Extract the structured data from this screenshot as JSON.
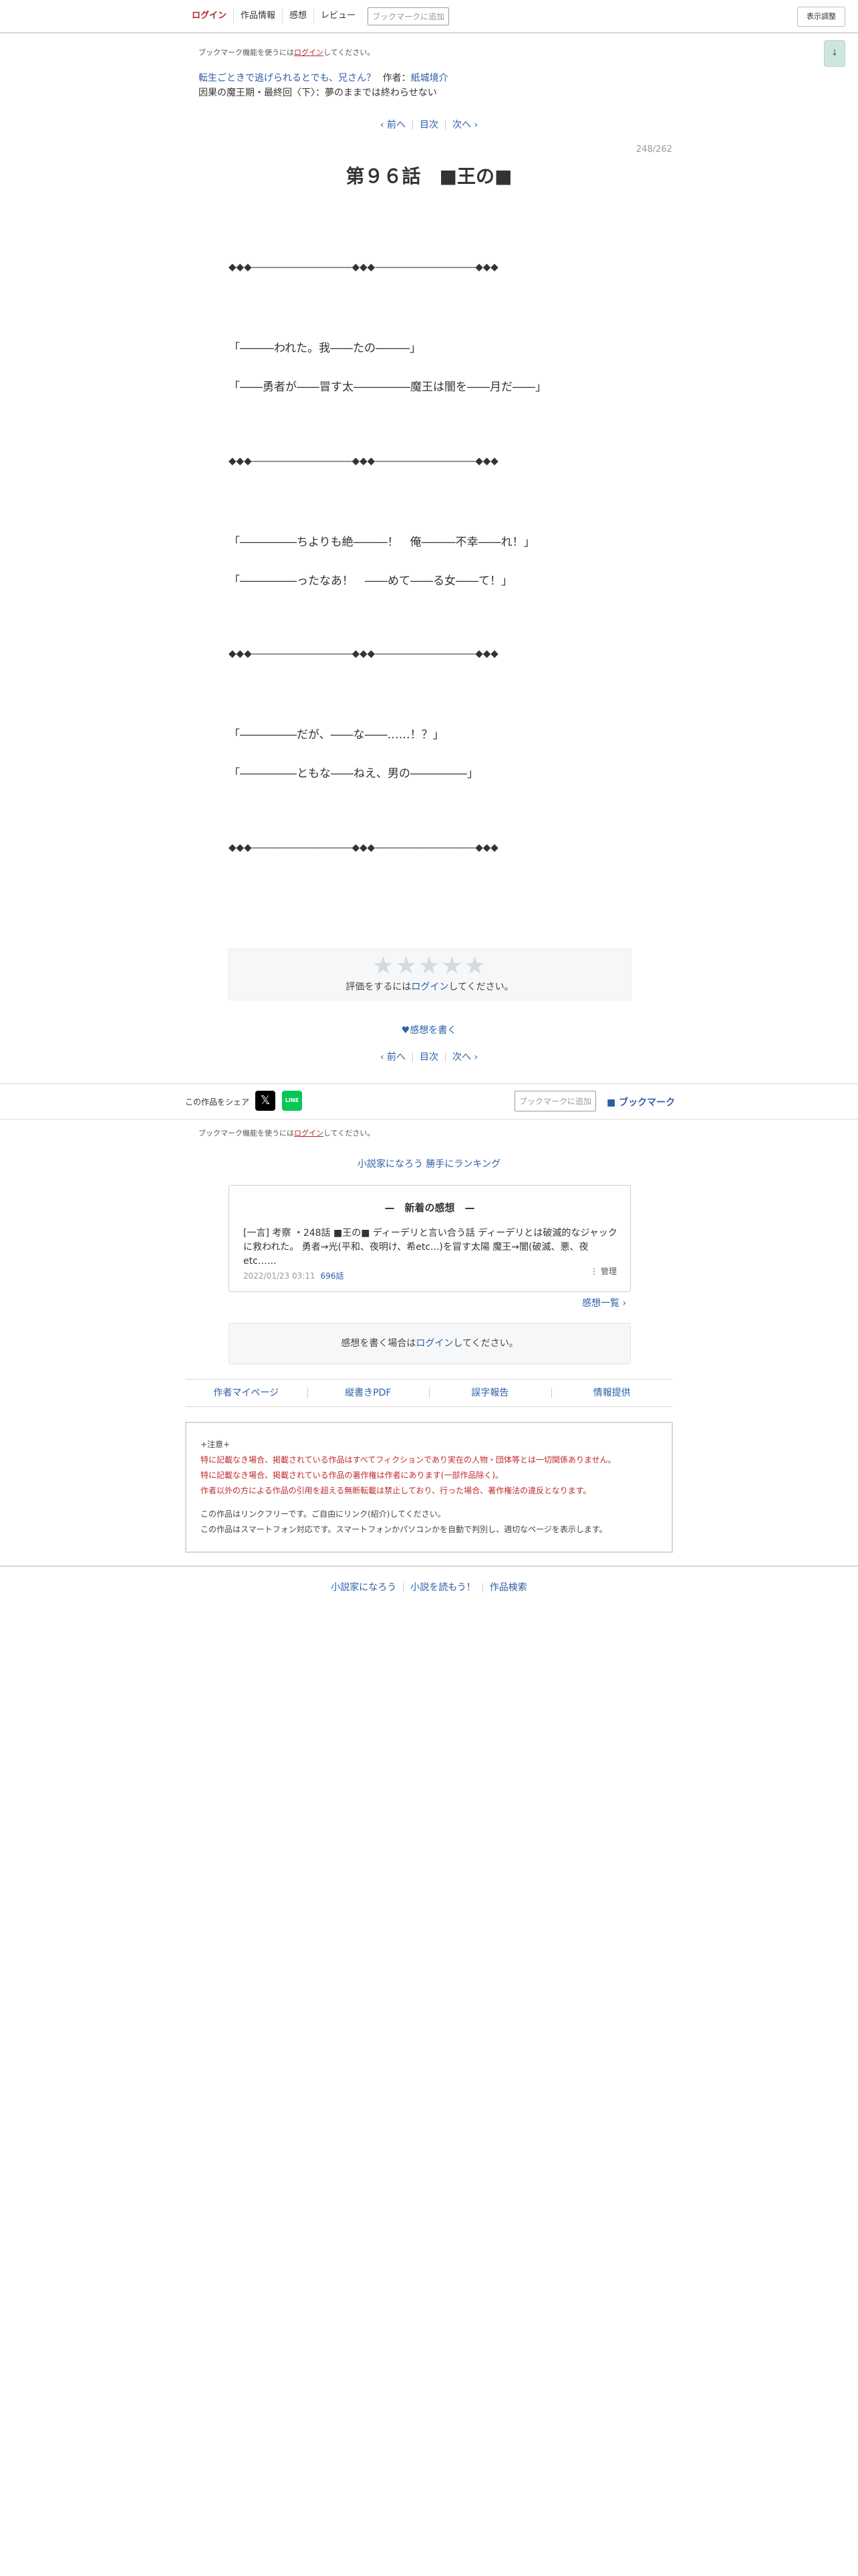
{
  "header": {
    "login": "ログイン",
    "work_info": "作品情報",
    "impressions": "感想",
    "review": "レビュー",
    "bookmark_btn": "ブックマークに追加",
    "display_adjust": "表示調整",
    "side_tab": "↓"
  },
  "bookmark_note": {
    "prefix": "ブックマーク機能を使うには",
    "login": "ログイン",
    "suffix": "してください。"
  },
  "novel": {
    "title": "転生ごときで逃げられるとでも、兄さん？",
    "author_label": "作者：",
    "author": "紙城境介",
    "chapter_subtitle": "因果の魔王期・最終回〈下〉：夢のままでは終わらせない"
  },
  "pager": {
    "prev": "‹ 前へ",
    "toc": "目次",
    "next": "次へ ›"
  },
  "episode": {
    "counter": "248/262",
    "title": "第９６話　■王の■"
  },
  "body": {
    "separator": "◆◆◆――――――――――◆◆◆――――――――――◆◆◆",
    "lines": [
      "「―――われた。我――たの―――」",
      "「――勇者が――冒す太―――――魔王は闇を――月だ――」",
      "「―――――ちよりも絶―――！　俺―――不幸――れ！」",
      "「―――――ったなあ！　――めて――る女――て！」",
      "「―――――だが、――な――……！？」",
      "「―――――ともな――ねえ、男の―――――」"
    ]
  },
  "rating": {
    "stars": [
      "★",
      "★",
      "★",
      "★",
      "★"
    ],
    "prefix": "評価をするには",
    "login": "ログイン",
    "suffix": "してください。"
  },
  "write_impression": "♥感想を書く",
  "share": {
    "label": "この作品をシェア",
    "x_icon": "𝕏",
    "line_icon": "LINE",
    "bookmark_btn": "ブックマークに追加",
    "bookmark_link": "■ ブックマーク"
  },
  "ranking": "小説家になろう 勝手にランキング",
  "latest_impression": {
    "heading": "—　新着の感想　—",
    "text": "[一言] 考察 ・248話 ■王の■ ディーデリと言い合う話 ディーデリとは破滅的なジャックに救われた。 勇者→光(平和、夜明け、希etc...)を冒す太陽 魔王→闇(破滅、悪、夜 etc……",
    "date": "2022/01/23 03:11",
    "count": "696話",
    "manage": "⋮ 管理",
    "list_link": "感想一覧 ›"
  },
  "write_box": {
    "prefix": "感想を書く場合は",
    "login": "ログイン",
    "suffix": "してください。"
  },
  "bottom_links": [
    "作者マイページ",
    "縦書きPDF",
    "誤字報告",
    "情報提供"
  ],
  "notice": {
    "title": "+注意+",
    "red_lines": [
      "特に記載なき場合、掲載されている作品はすべてフィクションであり実在の人物・団体等とは一切関係ありません。",
      "特に記載なき場合、掲載されている作品の著作権は作者にあります(一部作品除く)。",
      "作者以外の方による作品の引用を超える無断転載は禁止しており、行った場合、著作権法の違反となります。"
    ],
    "gray_lines": [
      "この作品はリンクフリーです。ご自由にリンク(紹介)してください。",
      "この作品はスマートフォン対応です。スマートフォンかパソコンかを自動で判別し、適切なページを表示します。"
    ]
  },
  "footer": [
    "小説家になろう",
    "小説を読もう！",
    "作品検索"
  ]
}
